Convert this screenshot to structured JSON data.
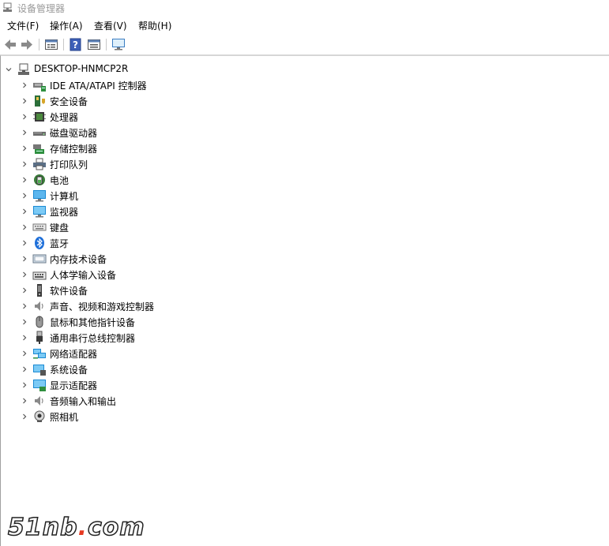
{
  "window": {
    "title": "设备管理器"
  },
  "menu": [
    {
      "label": "文件(F)"
    },
    {
      "label": "操作(A)"
    },
    {
      "label": "查看(V)"
    },
    {
      "label": "帮助(H)"
    }
  ],
  "toolbar": {
    "buttons": [
      "back-icon",
      "forward-icon",
      "properties-icon",
      "help-icon",
      "view-icon",
      "monitor-icon"
    ]
  },
  "tree": {
    "root": "DESKTOP-HNMCP2R",
    "items": [
      {
        "label": "IDE ATA/ATAPI 控制器",
        "icon": "ide-controller-icon"
      },
      {
        "label": "安全设备",
        "icon": "security-device-icon"
      },
      {
        "label": "处理器",
        "icon": "processor-icon"
      },
      {
        "label": "磁盘驱动器",
        "icon": "disk-drive-icon"
      },
      {
        "label": "存储控制器",
        "icon": "storage-controller-icon"
      },
      {
        "label": "打印队列",
        "icon": "printer-icon"
      },
      {
        "label": "电池",
        "icon": "battery-icon"
      },
      {
        "label": "计算机",
        "icon": "computer-icon"
      },
      {
        "label": "监视器",
        "icon": "monitor-icon"
      },
      {
        "label": "键盘",
        "icon": "keyboard-icon"
      },
      {
        "label": "蓝牙",
        "icon": "bluetooth-icon"
      },
      {
        "label": "内存技术设备",
        "icon": "memory-device-icon"
      },
      {
        "label": "人体学输入设备",
        "icon": "hid-icon"
      },
      {
        "label": "软件设备",
        "icon": "software-device-icon"
      },
      {
        "label": "声音、视频和游戏控制器",
        "icon": "sound-icon"
      },
      {
        "label": "鼠标和其他指针设备",
        "icon": "mouse-icon"
      },
      {
        "label": "通用串行总线控制器",
        "icon": "usb-icon"
      },
      {
        "label": "网络适配器",
        "icon": "network-adapter-icon"
      },
      {
        "label": "系统设备",
        "icon": "system-device-icon"
      },
      {
        "label": "显示适配器",
        "icon": "display-adapter-icon"
      },
      {
        "label": "音频输入和输出",
        "icon": "audio-io-icon"
      },
      {
        "label": "照相机",
        "icon": "camera-icon"
      }
    ]
  },
  "watermark": {
    "text_main": "51nb",
    "text_dot": ".",
    "text_tail": "com"
  }
}
